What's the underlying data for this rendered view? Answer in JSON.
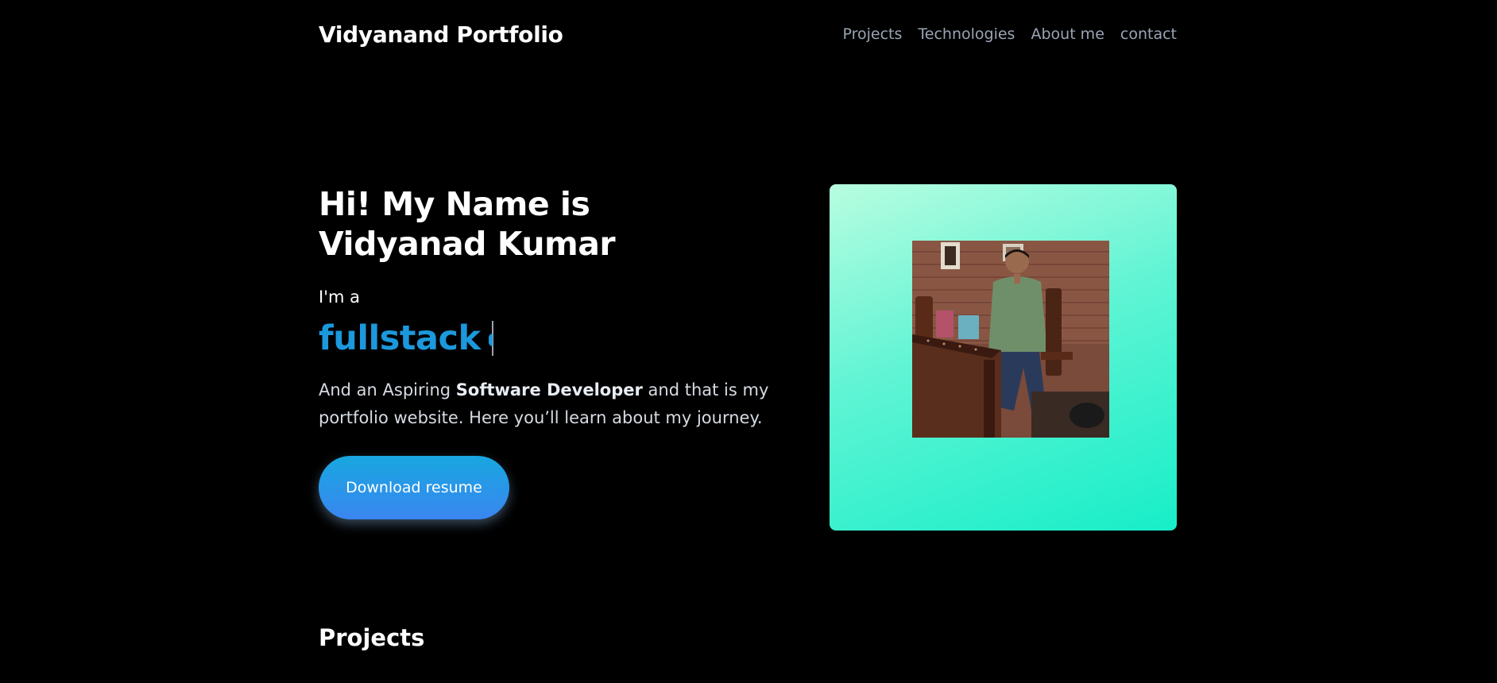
{
  "header": {
    "brand": "Vidyanand Portfolio",
    "nav": [
      {
        "label": "Projects"
      },
      {
        "label": "Technologies"
      },
      {
        "label": "About me"
      },
      {
        "label": "contact"
      }
    ]
  },
  "hero": {
    "greeting": "Hi! My Name is",
    "name": "Vidyanad Kumar",
    "intro": "I'm a",
    "role": "fullstack",
    "description": {
      "prefix": "And an Aspiring ",
      "highlight": "Software Developer",
      "suffix": " and that is my portfolio website. Here you’ll learn about my journey."
    },
    "button_label": "Download resume",
    "photo_icon": "portrait-photo-icon"
  },
  "projects": {
    "heading": "Projects"
  },
  "colors": {
    "background": "#000000",
    "accent": "#1c98dc",
    "nav_text": "#9aa5b4",
    "card_start": "#b8fde0",
    "card_end": "#17eec8"
  }
}
